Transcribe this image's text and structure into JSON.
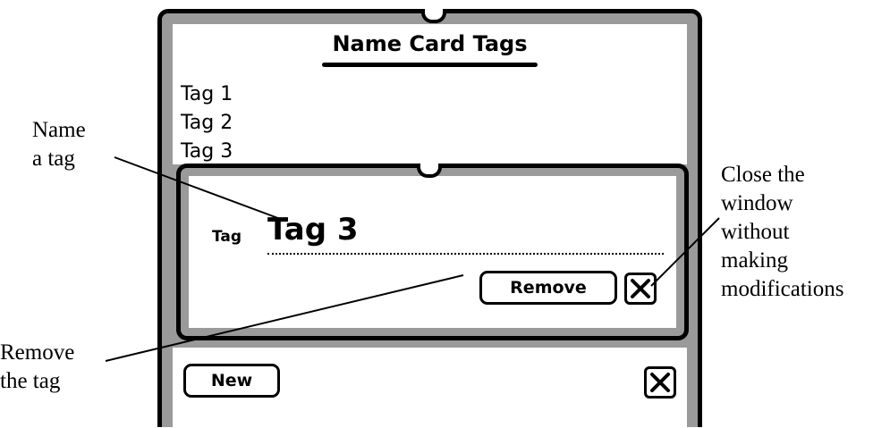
{
  "window": {
    "title": "Name Card Tags",
    "tags": [
      {
        "label": "Tag 1"
      },
      {
        "label": "Tag 2"
      },
      {
        "label": "Tag 3"
      }
    ],
    "new_button": "New"
  },
  "dialog": {
    "field_label": "Tag",
    "field_value": "Tag 3",
    "remove_button": "Remove"
  },
  "annotations": {
    "name_tag": [
      "Name",
      "a tag"
    ],
    "remove_tag": [
      "Remove",
      "the tag"
    ],
    "close_window": [
      "Close the",
      "window",
      "without",
      "making",
      "modifications"
    ]
  },
  "icons": {
    "dialog_close": "close-icon",
    "window_close": "close-icon"
  }
}
